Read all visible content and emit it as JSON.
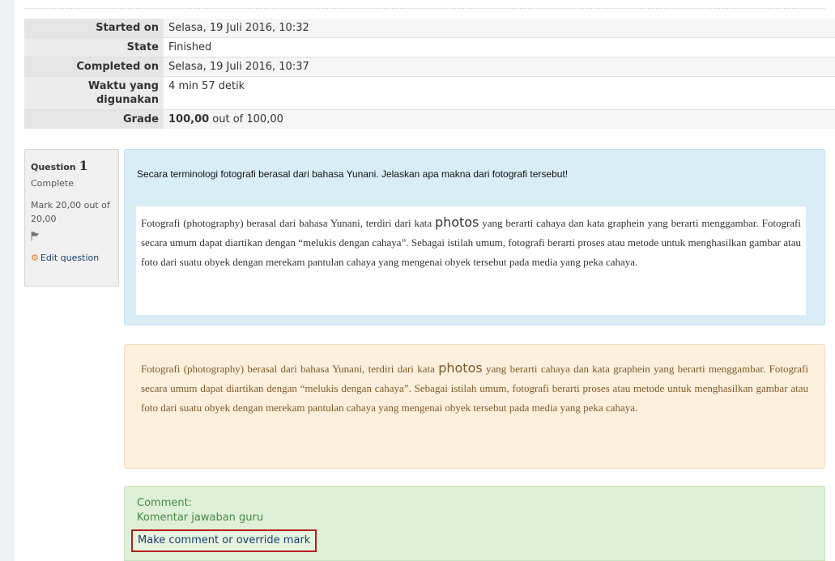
{
  "summary": {
    "rows": [
      {
        "label": "Started on",
        "value": "Selasa, 19 Juli 2016, 10:32"
      },
      {
        "label": "State",
        "value": "Finished"
      },
      {
        "label": "Completed on",
        "value": "Selasa, 19 Juli 2016, 10:37"
      },
      {
        "label": "Waktu yang digunakan",
        "value": "4 min 57 detik"
      },
      {
        "label": "Grade",
        "value_bold": "100,00",
        "value_rest": " out of 100,00"
      }
    ]
  },
  "question": {
    "label": "Question",
    "number": "1",
    "state": "Complete",
    "mark": "Mark 20,00 out of 20,00",
    "edit_label": "Edit question",
    "text": "Secara terminologi fotografi berasal dari bahasa Yunani. Jelaskan apa makna dari fotografi tersebut!",
    "answer": {
      "part1": "Fotografi (photography) berasal dari bahasa Yunani, terdiri dari kata ",
      "highlight": "photos",
      "part2": " yang berarti cahaya dan kata graphein yang berarti menggambar. Fotografi secara umum dapat diartikan dengan “melukis dengan cahaya”. Sebagai istilah umum, fotografi berarti proses atau metode untuk menghasilkan gambar atau foto dari suatu obyek dengan merekam pantulan cahaya yang mengenai obyek tersebut pada media yang peka cahaya."
    }
  },
  "feedback": {
    "part1": "Fotografi (photography) berasal dari bahasa Yunani, terdiri dari kata ",
    "highlight": "photos",
    "part2": " yang berarti cahaya dan kata graphein yang berarti menggambar. Fotografi secara umum dapat diartikan dengan “melukis dengan cahaya”. Sebagai istilah umum, fotografi berarti proses atau metode untuk menghasilkan gambar atau foto dari suatu obyek dengan merekam pantulan cahaya yang mengenai obyek tersebut pada media yang peka cahaya."
  },
  "comment": {
    "heading": "Comment:",
    "text": "Komentar jawaban guru",
    "override_label": "Make comment or override mark"
  }
}
